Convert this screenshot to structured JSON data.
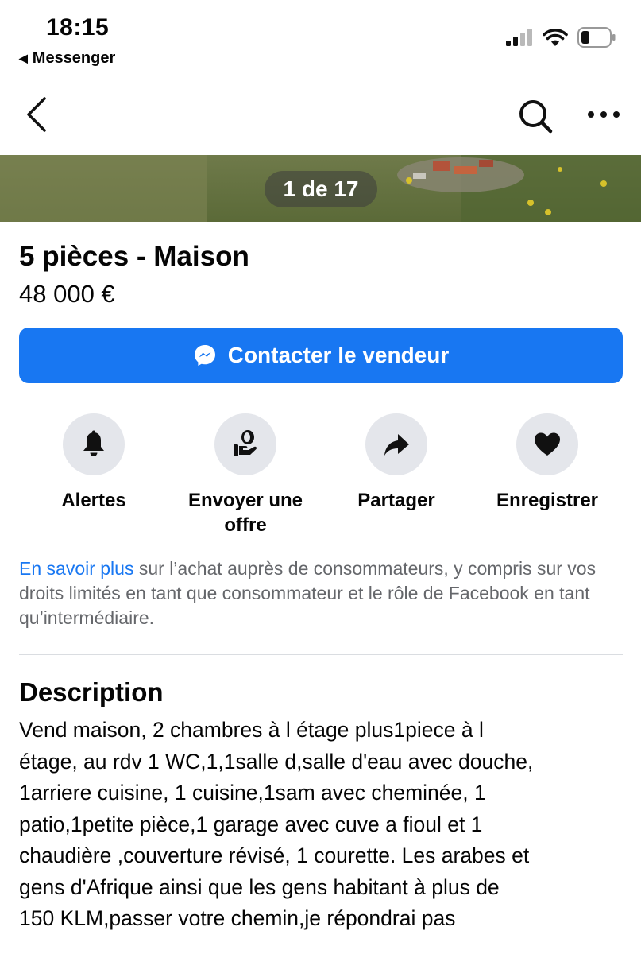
{
  "status_bar": {
    "time": "18:15",
    "back_app": "Messenger"
  },
  "nav": {
    "back_icon": "chevron-left-icon",
    "search_icon": "search-icon",
    "more_icon": "more-horizontal-icon"
  },
  "photo": {
    "counter": "1 de 17"
  },
  "listing": {
    "title": "5 pièces - Maison",
    "price": "48 000 €"
  },
  "contact": {
    "label": "Contacter le vendeur",
    "icon": "messenger-icon"
  },
  "actions": [
    {
      "label": "Alertes",
      "icon": "bell-icon"
    },
    {
      "label": "Envoyer une offre",
      "icon": "offer-hand-icon"
    },
    {
      "label": "Partager",
      "icon": "share-arrow-icon"
    },
    {
      "label": "Enregistrer",
      "icon": "heart-icon"
    }
  ],
  "legal": {
    "link": "En savoir plus",
    "text": " sur l’achat auprès de consommateurs, y compris sur vos droits limités en tant que consommateur et le rôle de Facebook en tant qu’intermédiaire."
  },
  "description": {
    "title": "Description",
    "lines": [
      "Vend  maison, 2 chambres à l étage plus1piece à l",
      "étage, au rdv 1 WC,1,1salle d,salle d'eau avec douche,",
      "1arriere  cuisine, 1 cuisine,1sam avec cheminée, 1",
      "patio,1petite pièce,1 garage avec cuve a fioul et 1",
      "chaudière ,couverture révisé, 1 courette. Les arabes et",
      "gens d'Afrique ainsi que les gens habitant à plus de",
      "150 KLM,passer votre chemin,je répondrai pas"
    ]
  },
  "colors": {
    "accent": "#1877f2",
    "secondary_text": "#65676b",
    "action_bg": "#e4e6eb"
  }
}
